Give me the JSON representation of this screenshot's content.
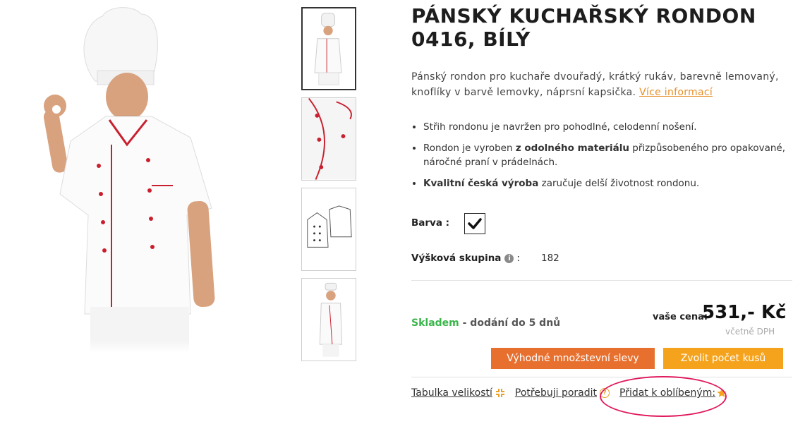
{
  "product": {
    "title": "PÁNSKÝ KUCHAŘSKÝ RONDON 0416, BÍLÝ",
    "description": "Pánský rondon pro kuchaře dvouřadý, krátký rukáv, barevně lemovaný, knoflíky v barvě lemovky, náprsní kapsička.",
    "more_info_link": "Více informací"
  },
  "bullets": [
    {
      "pre": "Střih rondonu je navržen pro pohodlné, celodenní nošení.",
      "bold": "",
      "post": ""
    },
    {
      "pre": "Rondon je vyroben ",
      "bold": "z odolného materiálu",
      "post": " přizpůsobeného pro opakované, náročné praní v prádelnách."
    },
    {
      "pre": "",
      "bold": "Kvalitní česká výroba",
      "post": " zaručuje delší životnost rondonu."
    }
  ],
  "color": {
    "label": "Barva :",
    "selected_icon": "check-icon",
    "swatch": "#ffffff"
  },
  "height": {
    "label": "Výšková skupina",
    "colon": ":",
    "value": "182",
    "info_icon": "i"
  },
  "stock": {
    "status": "Skladem",
    "delivery": " - dodání do 5 dnů",
    "status_color": "#39b54a"
  },
  "price": {
    "label": "vaše cena:",
    "value": "531,- Kč",
    "vat_note": "včetně DPH"
  },
  "buttons": {
    "discount": "Výhodné množstevní slevy",
    "quantity": "Zvolit počet kusů",
    "discount_color": "#e8702f",
    "quantity_color": "#f5a31c"
  },
  "links": {
    "sizes": "Tabulka velikostí",
    "advice": "Potřebuji poradit",
    "advice_icon": "?",
    "favorites": "Přidat k oblíbeným:"
  },
  "thumbnails": [
    {
      "name": "front-view",
      "active": true
    },
    {
      "name": "detail-view",
      "active": false
    },
    {
      "name": "technical-drawing",
      "active": false
    },
    {
      "name": "side-view",
      "active": false
    }
  ],
  "accent_color": "#e8902a",
  "highlight_color": "#e0195b"
}
